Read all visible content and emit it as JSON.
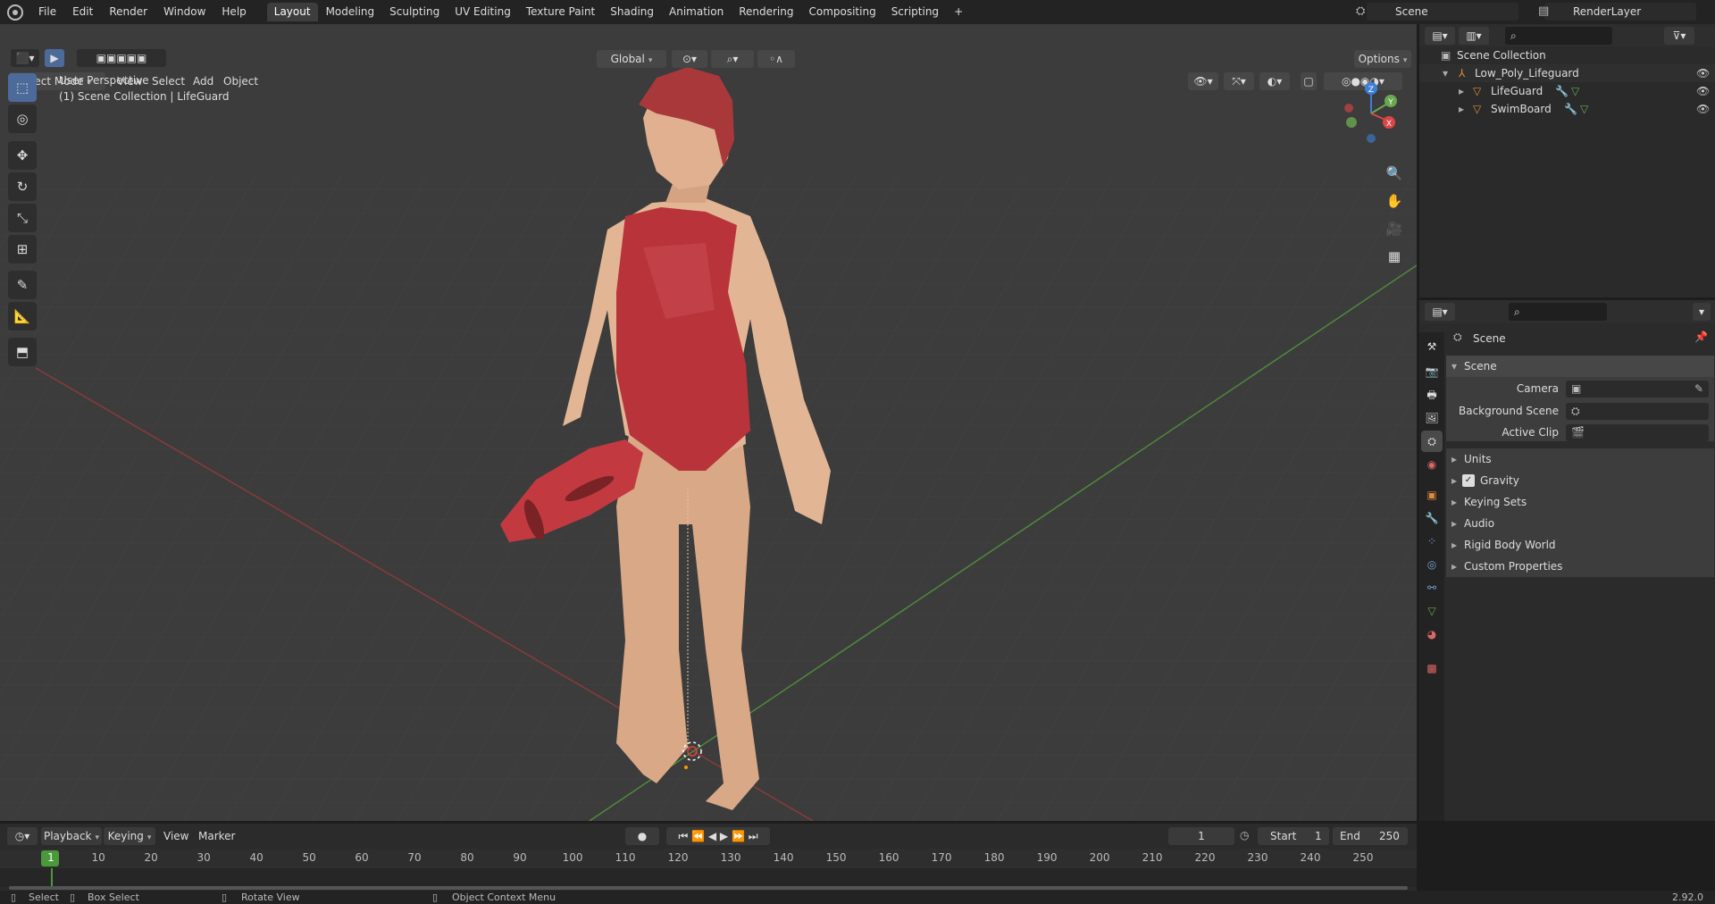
{
  "topbar": {
    "menus": [
      "File",
      "Edit",
      "Render",
      "Window",
      "Help"
    ],
    "workspaces": [
      "Layout",
      "Modeling",
      "Sculpting",
      "UV Editing",
      "Texture Paint",
      "Shading",
      "Animation",
      "Rendering",
      "Compositing",
      "Scripting"
    ],
    "active_workspace": "Layout",
    "add_tab": "+",
    "scene_name": "Scene",
    "render_layer": "RenderLayer"
  },
  "viewport": {
    "mode": "Object Mode",
    "menus": [
      "View",
      "Select",
      "Add",
      "Object"
    ],
    "orientation": "Global",
    "options_label": "Options",
    "info_line1": "User Perspective",
    "info_line2": "(1) Scene Collection | LifeGuard",
    "gizmo_axes": [
      "Z",
      "Y",
      "X"
    ]
  },
  "outliner": {
    "root": "Scene Collection",
    "collection": "Low_Poly_Lifeguard",
    "objects": [
      "LifeGuard",
      "SwimBoard"
    ]
  },
  "properties": {
    "context": "Scene",
    "panel_title": "Scene",
    "fields": [
      {
        "label": "Camera"
      },
      {
        "label": "Background Scene"
      },
      {
        "label": "Active Clip"
      }
    ],
    "subpanels": [
      "Units",
      "Gravity",
      "Keying Sets",
      "Audio",
      "Rigid Body World",
      "Custom Properties"
    ],
    "gravity_checked": true
  },
  "timeline": {
    "menus": [
      "Playback",
      "Keying",
      "View",
      "Marker"
    ],
    "current_frame": "1",
    "start_label": "Start",
    "start": "1",
    "end_label": "End",
    "end": "250",
    "ruler": [
      "1",
      "10",
      "20",
      "30",
      "40",
      "50",
      "60",
      "70",
      "80",
      "90",
      "100",
      "110",
      "120",
      "130",
      "140",
      "150",
      "160",
      "170",
      "180",
      "190",
      "200",
      "210",
      "220",
      "230",
      "240",
      "250"
    ]
  },
  "statusbar": {
    "select": "Select",
    "box_select": "Box Select",
    "rotate_view": "Rotate View",
    "context_menu": "Object Context Menu",
    "version": "2.92.0"
  },
  "colors": {
    "accent": "#4772b3",
    "swimsuit": "#b8343a",
    "skin": "#e2b695",
    "x_axis": "#9a3b3b",
    "y_axis": "#5a8f3a"
  }
}
